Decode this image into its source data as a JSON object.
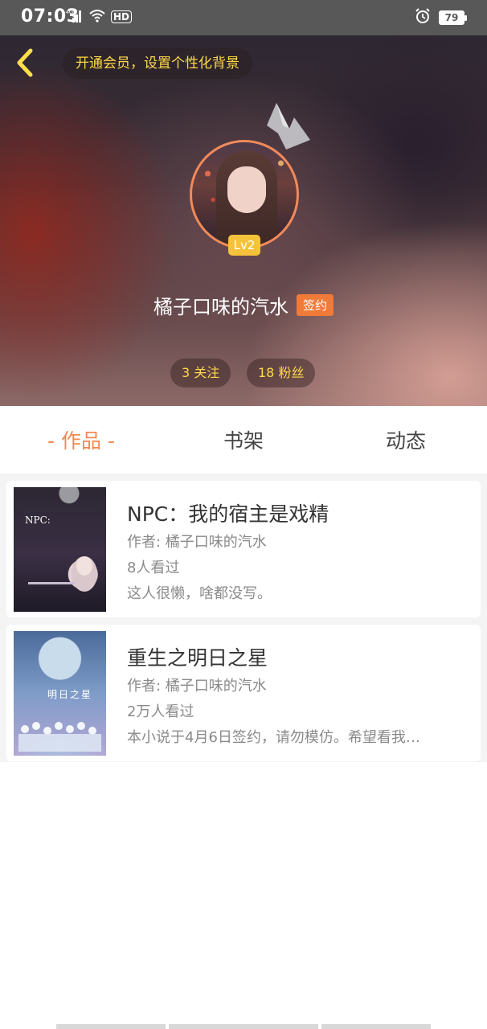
{
  "status_bar": {
    "time": "07:03",
    "network": "4G",
    "hd": "HD",
    "battery": "79"
  },
  "header": {
    "vip_banner": "开通会员，设置个性化背景",
    "username": "橘子口味的汽水",
    "sign_badge": "签约",
    "level": "Lv2",
    "follow": "3 关注",
    "fans": "18 粉丝"
  },
  "tabs": [
    {
      "label": "- 作品 -",
      "active": true
    },
    {
      "label": "书架",
      "active": false
    },
    {
      "label": "动态",
      "active": false
    }
  ],
  "books": [
    {
      "title": "NPC：我的宿主是戏精",
      "author": "作者: 橘子口味的汽水",
      "views": "8人看过",
      "desc": "这人很懒，啥都没写。",
      "cover_text": "NPC:"
    },
    {
      "title": "重生之明日之星",
      "author": "作者: 橘子口味的汽水",
      "views": "2万人看过",
      "desc": "本小说于4月6日签约，请勿模仿。希望看我…",
      "cover_text": "明日之星"
    }
  ],
  "colors": {
    "accent": "#f08a50",
    "vip_text": "#ffd94a",
    "level_badge": "#f5c33b",
    "sign_badge": "#f07a38"
  }
}
